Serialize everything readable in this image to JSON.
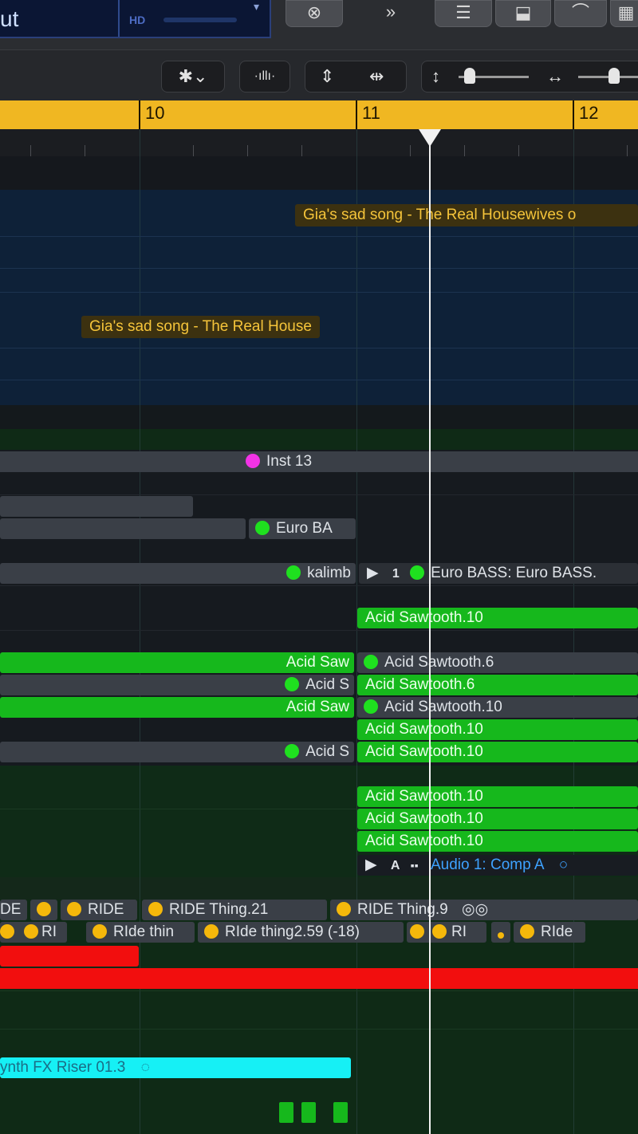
{
  "lcd": {
    "text": "ut",
    "hd_label": "HD"
  },
  "top_buttons": {
    "b1": "⊗",
    "b2": "»",
    "b3": "☰",
    "b4": "⬓",
    "b5": "⌒",
    "b6": "▦"
  },
  "toolbar": {
    "gear": "✱⌄",
    "wave": "·ıllı·",
    "vzoom": "⇕",
    "hzoom": "⇹",
    "vslider_icon": "↕",
    "hslider_icon": "↔",
    "vslider_level": 0.1,
    "hslider_level": 0.5
  },
  "ruler": {
    "bar10": "10",
    "bar11": "11",
    "bar12": "12"
  },
  "regions": {
    "gia1": "Gia's sad song - The Real Housewives o",
    "gia2": "Gia's sad song - The Real House",
    "inst13": "Inst 13",
    "eurobass_short": "Euro BA",
    "kalimba": "kalimb",
    "eurobass_long": "Euro BASS: Euro BASS.",
    "play_num": "1",
    "acid_saw_10_a": "Acid Sawtooth.10",
    "acid_saw_left_1": "Acid Saw",
    "acid_saw_6_a": "Acid Sawtooth.6",
    "acid_s_left_2": "Acid S",
    "acid_saw_6_b": "Acid Sawtooth.6",
    "acid_saw_left_3": "Acid Saw",
    "acid_saw_10_b": "Acid Sawtooth.10",
    "acid_saw_10_c": "Acid Sawtooth.10",
    "acid_s_left_4": "Acid S",
    "acid_saw_10_d": "Acid Sawtooth.10",
    "acid_saw_10_e": "Acid Sawtooth.10",
    "acid_saw_10_f": "Acid Sawtooth.10",
    "acid_saw_10_g": "Acid Sawtooth.10",
    "audio_a_label": "A",
    "audio_comp": "Audio 1: Comp A",
    "ride_de": "DE",
    "ride": "RIDE",
    "ride_thing21": "RIDE Thing.21",
    "ride_thing9": "RIDE Thing.9",
    "ri_1": "RI",
    "ride_thin": "RIde thin",
    "ride_thing2": "RIde thing2.59 (-18)",
    "ri_2": "RI",
    "ride_small": "RIde",
    "synth_fx": "ynth FX Riser 01.3"
  }
}
